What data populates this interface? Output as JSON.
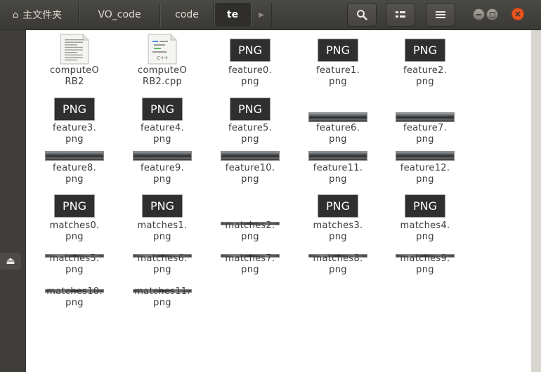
{
  "breadcrumbs": [
    "主文件夹",
    "VO_code",
    "code",
    "te"
  ],
  "files": [
    {
      "name": "computeORB2",
      "line1": "computeO",
      "line2": "RB2",
      "type": "text"
    },
    {
      "name": "computeORB2.cpp",
      "line1": "computeO",
      "line2": "RB2.cpp",
      "type": "cpp",
      "badge": "c++"
    },
    {
      "name": "feature0.png",
      "line1": "feature0.",
      "line2": "png",
      "type": "png",
      "badge": "PNG"
    },
    {
      "name": "feature1.png",
      "line1": "feature1.",
      "line2": "png",
      "type": "png",
      "badge": "PNG"
    },
    {
      "name": "feature2.png",
      "line1": "feature2.",
      "line2": "png",
      "type": "png",
      "badge": "PNG"
    },
    {
      "name": "feature3.png",
      "line1": "feature3.",
      "line2": "png",
      "type": "png",
      "badge": "PNG"
    },
    {
      "name": "feature4.png",
      "line1": "feature4.",
      "line2": "png",
      "type": "png",
      "badge": "PNG"
    },
    {
      "name": "feature5.png",
      "line1": "feature5.",
      "line2": "png",
      "type": "png",
      "badge": "PNG"
    },
    {
      "name": "feature6.png",
      "line1": "feature6.",
      "line2": "png",
      "type": "photo"
    },
    {
      "name": "feature7.png",
      "line1": "feature7.",
      "line2": "png",
      "type": "photo"
    },
    {
      "name": "feature8.png",
      "line1": "feature8.",
      "line2": "png",
      "type": "photo"
    },
    {
      "name": "feature9.png",
      "line1": "feature9.",
      "line2": "png",
      "type": "photo"
    },
    {
      "name": "feature10.png",
      "line1": "feature10.",
      "line2": "png",
      "type": "photo"
    },
    {
      "name": "feature11.png",
      "line1": "feature11.",
      "line2": "png",
      "type": "photo"
    },
    {
      "name": "feature12.png",
      "line1": "feature12.",
      "line2": "png",
      "type": "photo"
    },
    {
      "name": "matches0.png",
      "line1": "matches0.",
      "line2": "png",
      "type": "png",
      "badge": "PNG"
    },
    {
      "name": "matches1.png",
      "line1": "matches1.",
      "line2": "png",
      "type": "png",
      "badge": "PNG"
    },
    {
      "name": "matches2.png",
      "line1": "matches2.",
      "line2": "png",
      "type": "strip"
    },
    {
      "name": "matches3.png",
      "line1": "matches3.",
      "line2": "png",
      "type": "png",
      "badge": "PNG"
    },
    {
      "name": "matches4.png",
      "line1": "matches4.",
      "line2": "png",
      "type": "png",
      "badge": "PNG"
    },
    {
      "name": "matches5.png",
      "line1": "matches5.",
      "line2": "png",
      "type": "strip"
    },
    {
      "name": "matches6.png",
      "line1": "matches6.",
      "line2": "png",
      "type": "strip"
    },
    {
      "name": "matches7.png",
      "line1": "matches7.",
      "line2": "png",
      "type": "strip"
    },
    {
      "name": "matches8.png",
      "line1": "matches8.",
      "line2": "png",
      "type": "strip"
    },
    {
      "name": "matches9.png",
      "line1": "matches9.",
      "line2": "png",
      "type": "strip"
    },
    {
      "name": "matches10.png",
      "line1": "matches10.",
      "line2": "png",
      "type": "strip"
    },
    {
      "name": "matches11.png",
      "line1": "matches11.",
      "line2": "png",
      "type": "strip"
    }
  ],
  "toolbar": {
    "search_icon": "search-icon",
    "view_icon": "view-toggle-icon",
    "menu_icon": "menu-icon"
  },
  "colors": {
    "accent_close": "#e95420",
    "content_bg": "#ffffff",
    "header_bg": "#3c3b37"
  }
}
